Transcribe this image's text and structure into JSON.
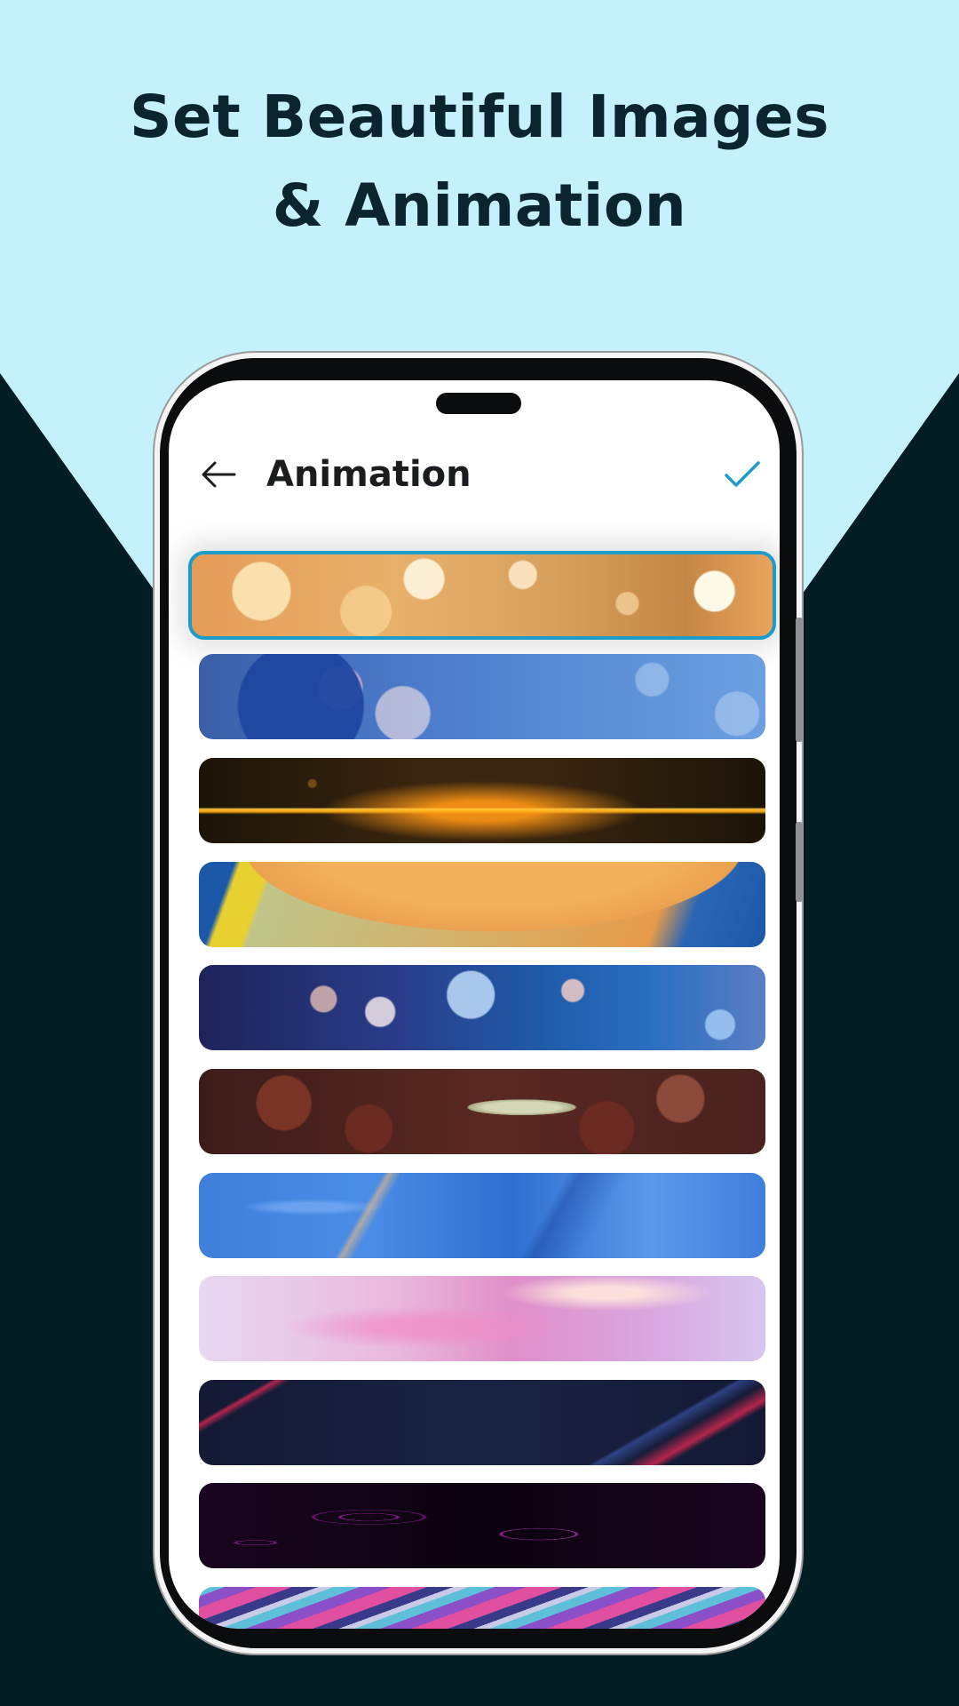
{
  "headline": {
    "line1": "Set Beautiful Images",
    "line2": "& Animation"
  },
  "app_bar": {
    "title": "Animation",
    "back_icon": "arrow-left-icon",
    "confirm_icon": "checkmark-icon"
  },
  "colors": {
    "top_background": "#c4f1fc",
    "bottom_background": "#021d23",
    "accent": "#1d9bc9",
    "headline_text": "#0b2530"
  },
  "animations": [
    {
      "name": "golden-bokeh-stars",
      "selected": true
    },
    {
      "name": "blue-christmas-ornament",
      "selected": false
    },
    {
      "name": "golden-light-streak",
      "selected": false
    },
    {
      "name": "orange-sphere-blue-waves",
      "selected": false
    },
    {
      "name": "blue-bokeh-lights",
      "selected": false
    },
    {
      "name": "succulent-plants",
      "selected": false
    },
    {
      "name": "blue-marble-fluid",
      "selected": false
    },
    {
      "name": "pink-clouds",
      "selected": false
    },
    {
      "name": "dark-navy-diagonal-lines",
      "selected": false
    },
    {
      "name": "purple-neon-swirls",
      "selected": false
    },
    {
      "name": "rainbow-stripes",
      "selected": false
    }
  ]
}
